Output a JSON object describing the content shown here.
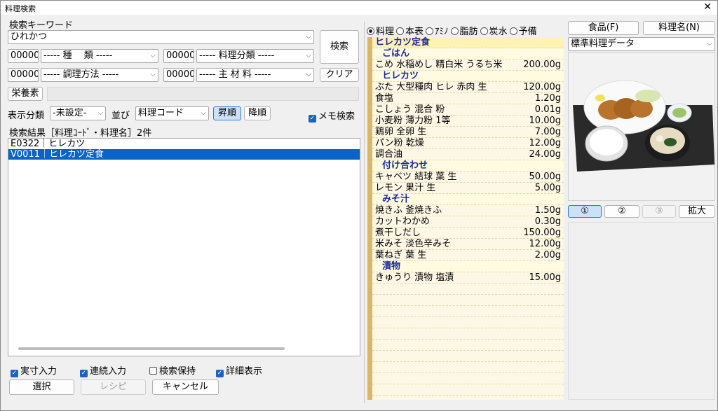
{
  "window": {
    "title": "料理検索",
    "close_glyph": "✕"
  },
  "search": {
    "label": "検索キーワード",
    "keyword": "ひれかつ",
    "search_button": "検索",
    "clear_button": "クリア",
    "nutrient_button": "栄養素"
  },
  "filters": [
    {
      "code": "00000",
      "label": "----- 種　 類 -----"
    },
    {
      "code": "00000",
      "label": "----- 料理分類 -----"
    },
    {
      "code": "00000",
      "label": "----- 調理方法 -----"
    },
    {
      "code": "00000",
      "label": "----- 主 材 料 -----"
    }
  ],
  "display": {
    "category_label": "表示分類",
    "category_value": "-未設定-",
    "sort_label": "並び",
    "sort_value": "料理コード",
    "asc_button": "昇順",
    "desc_button": "降順",
    "memo_search": "メモ検索"
  },
  "results": {
    "header": "検索結果［料理ｺｰﾄﾞ・料理名］2件",
    "rows": [
      {
        "text": "E0322｜ヒレカツ",
        "selected": false
      },
      {
        "text": "V0011｜ヒレカツ定食",
        "selected": true
      }
    ]
  },
  "options": [
    {
      "label": "実寸入力",
      "checked": true
    },
    {
      "label": "連続入力",
      "checked": true
    },
    {
      "label": "検索保持",
      "checked": false
    },
    {
      "label": "詳細表示",
      "checked": true
    }
  ],
  "actions": {
    "select": "選択",
    "recipe": "レシピ",
    "cancel": "キャンセル"
  },
  "tabs": [
    {
      "label": "料理",
      "selected": true
    },
    {
      "label": "本表",
      "selected": false
    },
    {
      "label": "ｱﾐﾉ",
      "selected": false
    },
    {
      "label": "脂肪",
      "selected": false
    },
    {
      "label": "炭水",
      "selected": false
    },
    {
      "label": "予備",
      "selected": false
    }
  ],
  "detail": [
    {
      "kind": "set",
      "name": "ヒレカツ定食",
      "amount": ""
    },
    {
      "kind": "hdr",
      "name": "ごはん",
      "amount": ""
    },
    {
      "kind": "item",
      "name": "こめ 水稲めし 精白米 うるち米",
      "amount": "200.00g"
    },
    {
      "kind": "hdr",
      "name": "ヒレカツ",
      "amount": ""
    },
    {
      "kind": "item",
      "name": "ぶた 大型種肉 ヒレ 赤肉 生",
      "amount": "120.00g"
    },
    {
      "kind": "item",
      "name": "食塩",
      "amount": "1.20g"
    },
    {
      "kind": "item",
      "name": "こしょう 混合 粉",
      "amount": "0.01g"
    },
    {
      "kind": "item",
      "name": "小麦粉 薄力粉 1等",
      "amount": "10.00g"
    },
    {
      "kind": "item",
      "name": "鶏卵 全卵 生",
      "amount": "7.00g"
    },
    {
      "kind": "item",
      "name": "パン粉 乾燥",
      "amount": "12.00g"
    },
    {
      "kind": "item",
      "name": "調合油",
      "amount": "24.00g"
    },
    {
      "kind": "hdr",
      "name": "付け合わせ",
      "amount": ""
    },
    {
      "kind": "item",
      "name": "キャベツ 結球 葉 生",
      "amount": "50.00g"
    },
    {
      "kind": "item",
      "name": "レモン 果汁 生",
      "amount": "5.00g"
    },
    {
      "kind": "hdr",
      "name": "みそ汁",
      "amount": ""
    },
    {
      "kind": "item",
      "name": "焼きふ 釜焼きふ",
      "amount": "1.50g"
    },
    {
      "kind": "item",
      "name": "カットわかめ",
      "amount": "0.30g"
    },
    {
      "kind": "item",
      "name": "煮干しだし",
      "amount": "150.00g"
    },
    {
      "kind": "item",
      "name": "米みそ 淡色辛みそ",
      "amount": "12.00g"
    },
    {
      "kind": "item",
      "name": "葉ねぎ 葉 生",
      "amount": "2.00g"
    },
    {
      "kind": "hdr",
      "name": "漬物",
      "amount": ""
    },
    {
      "kind": "item",
      "name": "きゅうり 漬物 塩漬",
      "amount": "15.00g"
    }
  ],
  "right": {
    "food_button": "食品(F)",
    "dishname_button": "料理名(N)",
    "source_value": "標準料理データ",
    "img_buttons": [
      "①",
      "②",
      "③"
    ],
    "zoom_button": "拡大"
  }
}
